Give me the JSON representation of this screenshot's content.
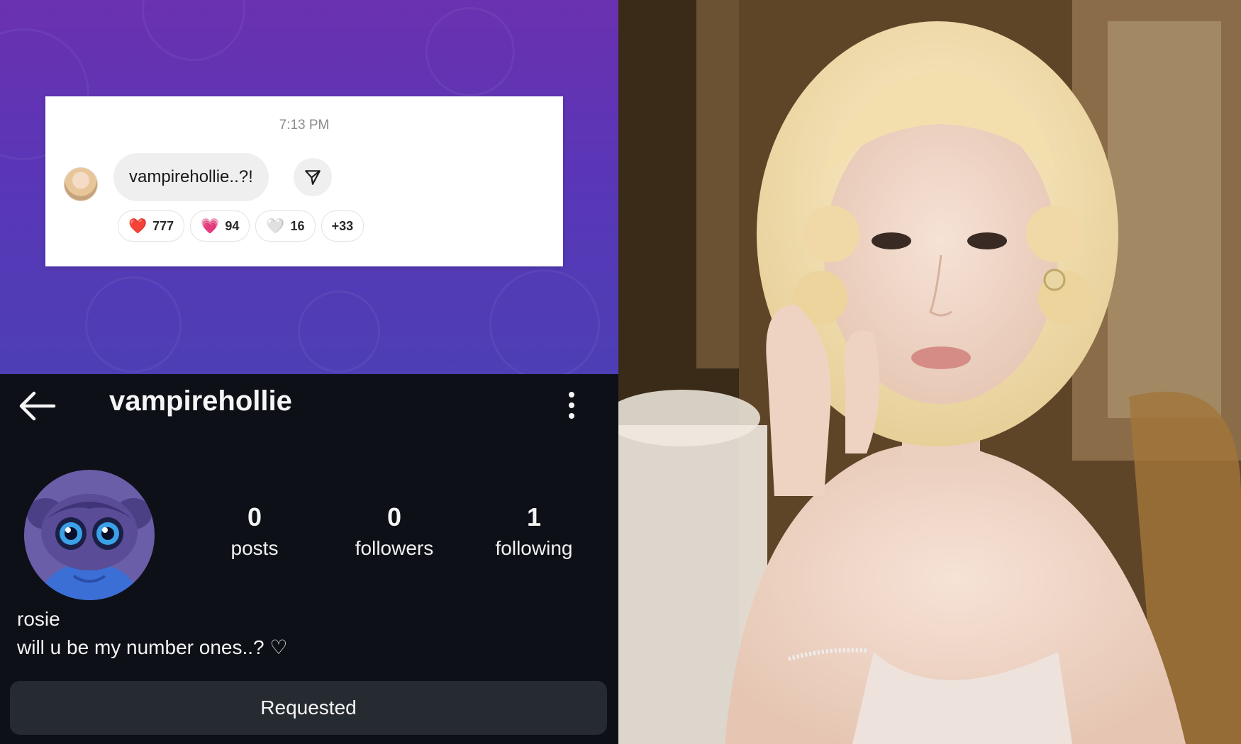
{
  "message_card": {
    "time": "7:13 PM",
    "message": "vampirehollie..?!",
    "reactions": [
      {
        "emoji": "❤️",
        "count": "777"
      },
      {
        "emoji": "💗",
        "count": "94"
      },
      {
        "emoji": "🤍",
        "count": "16"
      }
    ],
    "more_reactions": "+33"
  },
  "profile": {
    "username": "vampirehollie",
    "stats": [
      {
        "value": "0",
        "label": "posts"
      },
      {
        "value": "0",
        "label": "followers"
      },
      {
        "value": "1",
        "label": "following"
      }
    ],
    "name": "rosie",
    "bio": "will u be my number ones..? ♡",
    "follow_button": "Requested"
  },
  "colors": {
    "purple_top": "#6a31b0",
    "purple_bottom": "#4d3fb6",
    "profile_bg": "#0d1017",
    "button_bg": "#262a31",
    "avatar_purple": "#6b5ea8",
    "avatar_blue": "#3b6fd6"
  }
}
